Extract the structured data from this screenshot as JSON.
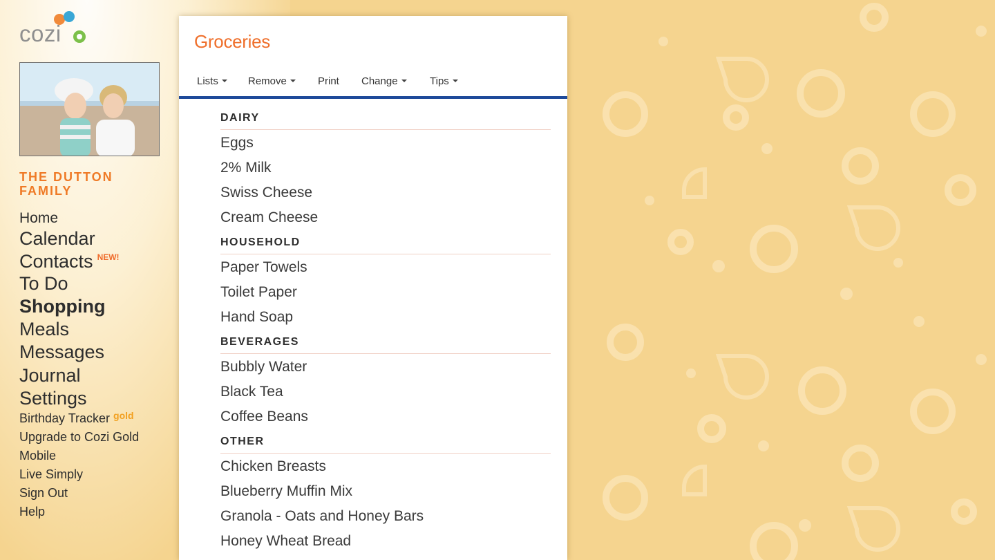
{
  "app": {
    "logo_text": "cozi"
  },
  "family": {
    "name": "THE DUTTON FAMILY"
  },
  "nav": {
    "items": [
      {
        "label": "Home"
      },
      {
        "label": "Calendar"
      },
      {
        "label": "Contacts",
        "badge": "NEW!"
      },
      {
        "label": "To Do"
      },
      {
        "label": "Shopping"
      },
      {
        "label": "Meals"
      },
      {
        "label": "Messages"
      },
      {
        "label": "Journal"
      },
      {
        "label": "Settings"
      },
      {
        "label": "Birthday Tracker",
        "badge": "gold"
      },
      {
        "label": "Upgrade to Cozi Gold"
      },
      {
        "label": "Mobile"
      },
      {
        "label": "Live Simply"
      },
      {
        "label": "Sign Out"
      },
      {
        "label": "Help"
      }
    ]
  },
  "panel": {
    "title": "Groceries",
    "toolbar": [
      {
        "label": "Lists",
        "dropdown": true
      },
      {
        "label": "Remove",
        "dropdown": true
      },
      {
        "label": "Print",
        "dropdown": false
      },
      {
        "label": "Change",
        "dropdown": true
      },
      {
        "label": "Tips",
        "dropdown": true
      }
    ],
    "categories": [
      {
        "name": "DAIRY",
        "items": [
          "Eggs",
          "2% Milk",
          "Swiss Cheese",
          "Cream Cheese"
        ]
      },
      {
        "name": "HOUSEHOLD",
        "items": [
          "Paper Towels",
          "Toilet Paper",
          "Hand Soap"
        ]
      },
      {
        "name": "BEVERAGES",
        "items": [
          "Bubbly Water",
          "Black Tea",
          "Coffee Beans"
        ]
      },
      {
        "name": "OTHER",
        "items": [
          "Chicken Breasts",
          "Blueberry Muffin Mix",
          "Granola - Oats and Honey Bars",
          "Honey Wheat Bread"
        ]
      }
    ]
  },
  "colors": {
    "accent": "#ef7a26",
    "toolbar_rule": "#1e4a9a",
    "background": "#f5d48f"
  }
}
